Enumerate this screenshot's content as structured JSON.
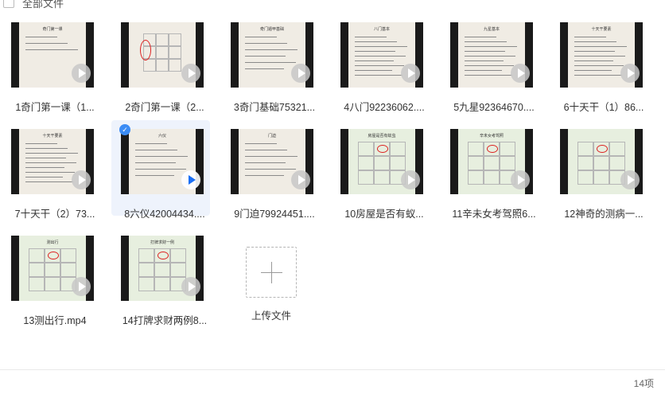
{
  "header": {
    "select_all_label": "全部文件"
  },
  "files": [
    {
      "name": "1奇门第一课（1...",
      "slide_title": "奇门第一课",
      "style": "title"
    },
    {
      "name": "2奇门第一课（2...",
      "slide_title": "",
      "style": "grid"
    },
    {
      "name": "3奇门基础75321...",
      "slide_title": "奇门遁甲基础",
      "style": "text"
    },
    {
      "name": "4八门92236062....",
      "slide_title": "八门基本",
      "style": "dense"
    },
    {
      "name": "5九星92364670....",
      "slide_title": "九星基本",
      "style": "dense"
    },
    {
      "name": "6十天干（1）86...",
      "slide_title": "十天干要素",
      "style": "dense"
    },
    {
      "name": "7十天干（2）73...",
      "slide_title": "十天干要素",
      "style": "dense"
    },
    {
      "name": "8六仪42004434....",
      "slide_title": "六仪",
      "style": "text",
      "selected": true
    },
    {
      "name": "9门迫79924451....",
      "slide_title": "门迫",
      "style": "text"
    },
    {
      "name": "10房屋是否有蚁...",
      "slide_title": "房屋是否有蚁虫",
      "style": "chart"
    },
    {
      "name": "11辛未女考驾照6...",
      "slide_title": "辛未女考驾照",
      "style": "chart"
    },
    {
      "name": "12神奇的测病一...",
      "slide_title": "",
      "style": "chart-dark"
    },
    {
      "name": "13测出行.mp4",
      "slide_title": "测出行",
      "style": "chart"
    },
    {
      "name": "14打牌求财两例8...",
      "slide_title": "打牌求财一例",
      "style": "chart"
    }
  ],
  "upload": {
    "label": "上传文件"
  },
  "footer": {
    "count": "14项"
  },
  "colors": {
    "accent": "#1b6ff5",
    "select_bg": "#eef3fc",
    "ink": "#dd2222"
  }
}
